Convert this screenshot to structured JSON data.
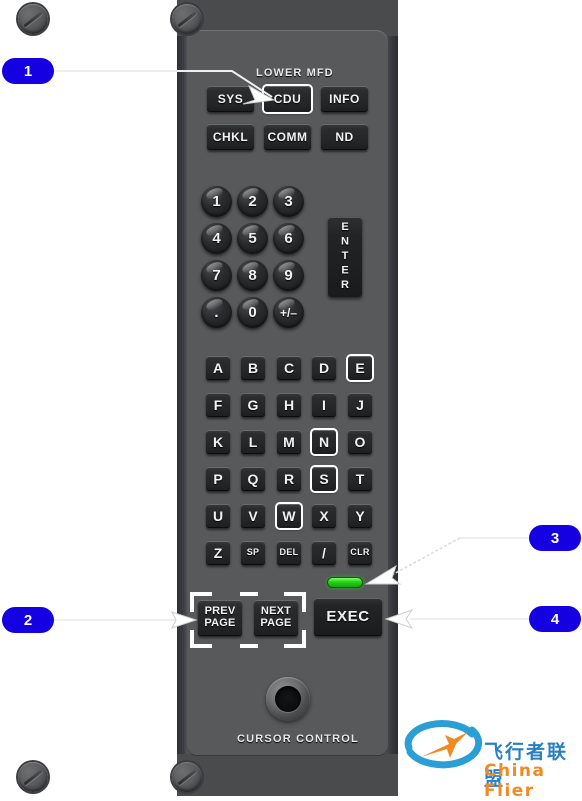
{
  "panel": {
    "title_label": "LOWER MFD",
    "cursor_control_label": "CURSOR  CONTROL",
    "mfd_buttons": [
      {
        "label": "SYS",
        "selected": false
      },
      {
        "label": "CDU",
        "selected": true
      },
      {
        "label": "INFO",
        "selected": false
      },
      {
        "label": "CHKL",
        "selected": false
      },
      {
        "label": "COMM",
        "selected": false
      },
      {
        "label": "ND",
        "selected": false
      }
    ],
    "numeric_keys": [
      {
        "label": "1"
      },
      {
        "label": "2"
      },
      {
        "label": "3"
      },
      {
        "label": "4"
      },
      {
        "label": "5"
      },
      {
        "label": "6"
      },
      {
        "label": "7"
      },
      {
        "label": "8"
      },
      {
        "label": "9"
      },
      {
        "label": "."
      },
      {
        "label": "0"
      },
      {
        "label": "+/–"
      }
    ],
    "enter_key_label": "ENTER",
    "alpha_keys": [
      {
        "label": "A",
        "selected": false
      },
      {
        "label": "B",
        "selected": false
      },
      {
        "label": "C",
        "selected": false
      },
      {
        "label": "D",
        "selected": false
      },
      {
        "label": "E",
        "selected": true
      },
      {
        "label": "F",
        "selected": false
      },
      {
        "label": "G",
        "selected": false
      },
      {
        "label": "H",
        "selected": false
      },
      {
        "label": "I",
        "selected": false
      },
      {
        "label": "J",
        "selected": false
      },
      {
        "label": "K",
        "selected": false
      },
      {
        "label": "L",
        "selected": false
      },
      {
        "label": "M",
        "selected": false
      },
      {
        "label": "N",
        "selected": true
      },
      {
        "label": "O",
        "selected": false
      },
      {
        "label": "P",
        "selected": false
      },
      {
        "label": "Q",
        "selected": false
      },
      {
        "label": "R",
        "selected": false
      },
      {
        "label": "S",
        "selected": true
      },
      {
        "label": "T",
        "selected": false
      },
      {
        "label": "U",
        "selected": false
      },
      {
        "label": "V",
        "selected": false
      },
      {
        "label": "W",
        "selected": true
      },
      {
        "label": "X",
        "selected": false
      },
      {
        "label": "Y",
        "selected": false
      },
      {
        "label": "Z",
        "selected": false
      },
      {
        "label": "SP",
        "selected": false,
        "small": true
      },
      {
        "label": "DEL",
        "selected": false,
        "small": true
      },
      {
        "label": "/",
        "selected": false
      },
      {
        "label": "CLR",
        "selected": false,
        "small": true
      }
    ],
    "page_keys": [
      {
        "line1": "PREV",
        "line2": "PAGE",
        "highlighted": true
      },
      {
        "line1": "NEXT",
        "line2": "PAGE",
        "highlighted": true
      }
    ],
    "exec_label": "EXEC",
    "led": {
      "name": "exec-indicator-led",
      "color": "#22d117",
      "state": "on"
    }
  },
  "callouts": [
    {
      "number": "1",
      "target": "cdu-button"
    },
    {
      "number": "2",
      "target": "prev-next-page-keys"
    },
    {
      "number": "3",
      "target": "exec-indicator-led"
    },
    {
      "number": "4",
      "target": "exec-button"
    }
  ],
  "watermark": {
    "chinese": "飞行者联盟",
    "english": "China Flier",
    "blue": "#2a7fc4",
    "orange": "#f08a23"
  }
}
